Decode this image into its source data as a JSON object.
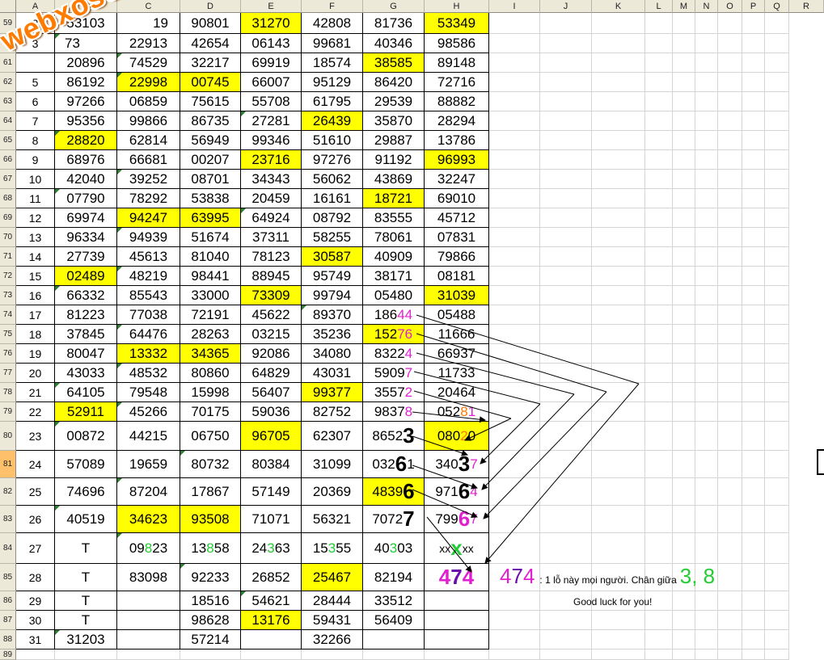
{
  "columns": [
    "A",
    "B",
    "C",
    "D",
    "E",
    "F",
    "G",
    "H",
    "I",
    "J",
    "K",
    "L",
    "M",
    "N",
    "O",
    "P",
    "Q",
    "R"
  ],
  "watermark": "webxoso.net",
  "rows": [
    {
      "row": "59",
      "a": "2",
      "cells": [
        "53103",
        "",
        "90801",
        "31270",
        "42808",
        "81736",
        "53349"
      ],
      "hl": [
        3,
        6
      ]
    },
    {
      "row": "60",
      "a": "3",
      "cells": [
        "",
        "22913",
        "42654",
        "06143",
        "99681",
        "40346",
        "98586"
      ],
      "hl": []
    },
    {
      "row": "61",
      "a": "",
      "cells": [
        "",
        "74529",
        "32217",
        "69919",
        "18574",
        "38585",
        "89148"
      ],
      "hl": [
        5
      ]
    },
    {
      "row": "62",
      "a": "5",
      "cells": [
        "86192",
        "22998",
        "00745",
        "66007",
        "95129",
        "86420",
        "72716"
      ],
      "hl": [
        1,
        2
      ]
    },
    {
      "row": "63",
      "a": "6",
      "cells": [
        "97266",
        "06859",
        "75615",
        "55708",
        "61795",
        "29539",
        "88882"
      ],
      "hl": []
    },
    {
      "row": "64",
      "a": "7",
      "cells": [
        "95356",
        "99866",
        "86735",
        "27281",
        "26439",
        "35870",
        "28294"
      ],
      "hl": [
        4
      ]
    },
    {
      "row": "65",
      "a": "8",
      "cells": [
        "28820",
        "62814",
        "56949",
        "99346",
        "51610",
        "29887",
        "13786"
      ],
      "hl": [
        0
      ]
    },
    {
      "row": "66",
      "a": "9",
      "cells": [
        "68976",
        "66681",
        "00207",
        "23716",
        "97276",
        "91192",
        "96993"
      ],
      "hl": [
        3,
        6
      ]
    },
    {
      "row": "67",
      "a": "10",
      "cells": [
        "42040",
        "39252",
        "08701",
        "34343",
        "56062",
        "43869",
        "32247"
      ],
      "hl": []
    },
    {
      "row": "68",
      "a": "11",
      "cells": [
        "07790",
        "78292",
        "53838",
        "20459",
        "16161",
        "18721",
        "69010"
      ],
      "hl": [
        5
      ]
    },
    {
      "row": "69",
      "a": "12",
      "cells": [
        "69974",
        "94247",
        "63995",
        "64924",
        "08792",
        "83555",
        "45712"
      ],
      "hl": [
        1,
        2
      ]
    },
    {
      "row": "70",
      "a": "13",
      "cells": [
        "96334",
        "94939",
        "51674",
        "37311",
        "58255",
        "78061",
        "07831"
      ],
      "hl": []
    },
    {
      "row": "71",
      "a": "14",
      "cells": [
        "27739",
        "45613",
        "81040",
        "78123",
        "30587",
        "40909",
        "79866"
      ],
      "hl": [
        4
      ]
    },
    {
      "row": "72",
      "a": "15",
      "cells": [
        "02489",
        "48219",
        "98441",
        "88945",
        "95749",
        "38171",
        "08181"
      ],
      "hl": [
        0
      ]
    },
    {
      "row": "73",
      "a": "16",
      "cells": [
        "66332",
        "85543",
        "33000",
        "73309",
        "99794",
        "05480",
        "31039"
      ],
      "hl": [
        3,
        6
      ]
    },
    {
      "row": "74",
      "a": "17",
      "cells": [
        "81223",
        "77038",
        "72191",
        "45622",
        "89370",
        "",
        "05488"
      ],
      "hl": []
    },
    {
      "row": "75",
      "a": "18",
      "cells": [
        "37845",
        "64476",
        "28263",
        "03215",
        "35236",
        "",
        "11666"
      ],
      "hl": [
        5
      ]
    },
    {
      "row": "76",
      "a": "19",
      "cells": [
        "80047",
        "13332",
        "34365",
        "92086",
        "34080",
        "",
        "66937"
      ],
      "hl": [
        1,
        2
      ]
    },
    {
      "row": "77",
      "a": "20",
      "cells": [
        "43033",
        "48532",
        "80860",
        "64829",
        "43031",
        "",
        "11733"
      ],
      "hl": []
    },
    {
      "row": "78",
      "a": "21",
      "cells": [
        "64105",
        "79548",
        "15998",
        "56407",
        "99377",
        "",
        "20464"
      ],
      "hl": [
        4
      ]
    },
    {
      "row": "79",
      "a": "22",
      "cells": [
        "52911",
        "45266",
        "70175",
        "59036",
        "82752",
        "",
        ""
      ],
      "hl": [
        0
      ]
    },
    {
      "row": "80",
      "a": "23",
      "cells": [
        "00872",
        "44215",
        "06750",
        "96705",
        "62307",
        "",
        ""
      ],
      "hl": [
        3,
        6
      ]
    },
    {
      "row": "81",
      "a": "24",
      "cells": [
        "57089",
        "19659",
        "80732",
        "80384",
        "31099",
        "",
        ""
      ],
      "hl": []
    },
    {
      "row": "82",
      "a": "25",
      "cells": [
        "74696",
        "87204",
        "17867",
        "57149",
        "20369",
        "",
        ""
      ],
      "hl": [
        5
      ]
    },
    {
      "row": "83",
      "a": "26",
      "cells": [
        "40519",
        "34623",
        "93508",
        "71071",
        "56321",
        "",
        ""
      ],
      "hl": [
        1,
        2
      ]
    },
    {
      "row": "84",
      "a": "27",
      "cells": [
        "T",
        "",
        "",
        "",
        "",
        "",
        ""
      ],
      "hl": []
    },
    {
      "row": "85",
      "a": "28",
      "cells": [
        "T",
        "83098",
        "92233",
        "26852",
        "25467",
        "82194",
        ""
      ],
      "hl": [
        4
      ]
    },
    {
      "row": "86",
      "a": "29",
      "cells": [
        "T",
        "",
        "18516",
        "54621",
        "28444",
        "33512",
        ""
      ],
      "hl": []
    },
    {
      "row": "87",
      "a": "30",
      "cells": [
        "T",
        "",
        "98628",
        "13176",
        "59431",
        "56409",
        ""
      ],
      "hl": [
        3
      ]
    },
    {
      "row": "88",
      "a": "31",
      "cells": [
        "31203",
        "",
        "57214",
        "",
        "32266",
        "",
        ""
      ],
      "hl": []
    },
    {
      "row": "89",
      "a": "",
      "cells": [],
      "hl": []
    }
  ],
  "special": {
    "r59_c": [
      "",
      "",
      "19"
    ],
    "r60_b": "73",
    "r61_b": "20896",
    "r61_a": "",
    "r74_g": [
      "186",
      "44"
    ],
    "r75_g": [
      "152",
      "76"
    ],
    "r76_g": [
      "8322",
      "4"
    ],
    "r77_g": [
      "5909",
      "7"
    ],
    "r78_g": [
      "3557",
      "2"
    ],
    "r79_g": [
      "9837",
      "8"
    ],
    "r79_h": [
      "052",
      "8",
      "1"
    ],
    "r80_g": [
      "8652",
      "3"
    ],
    "r80_h": [
      "080",
      "2",
      "0"
    ],
    "r81_g": [
      "032",
      "6",
      "1"
    ],
    "r81_h": [
      "340",
      "3",
      "7"
    ],
    "r82_g": [
      "4839",
      "6"
    ],
    "r82_h": [
      "971",
      "6",
      "4"
    ],
    "r83_g": [
      "7072",
      "7"
    ],
    "r83_h": [
      "799",
      "6",
      "7"
    ],
    "r84_c": [
      "09",
      "8",
      "23"
    ],
    "r84_d": [
      "13",
      "8",
      "58"
    ],
    "r84_e": [
      "24",
      "3",
      "63"
    ],
    "r84_f": [
      "15",
      "3",
      "55"
    ],
    "r84_g": [
      "40",
      "3",
      "03"
    ],
    "r84_h": [
      "xx",
      "x",
      "xx"
    ],
    "r85_h": [
      "4",
      "7",
      "4"
    ]
  },
  "note": {
    "n474": [
      "4",
      "7",
      "4"
    ],
    "text": ": 1 lỗ này mọi người. Chân giữa",
    "nums": "3, 8",
    "goodluck": "Good luck for you!"
  },
  "colors": {
    "highlight": "#ffff00",
    "magenta": "#e020d0",
    "green": "#22cc33",
    "orange": "#ff7a00"
  }
}
